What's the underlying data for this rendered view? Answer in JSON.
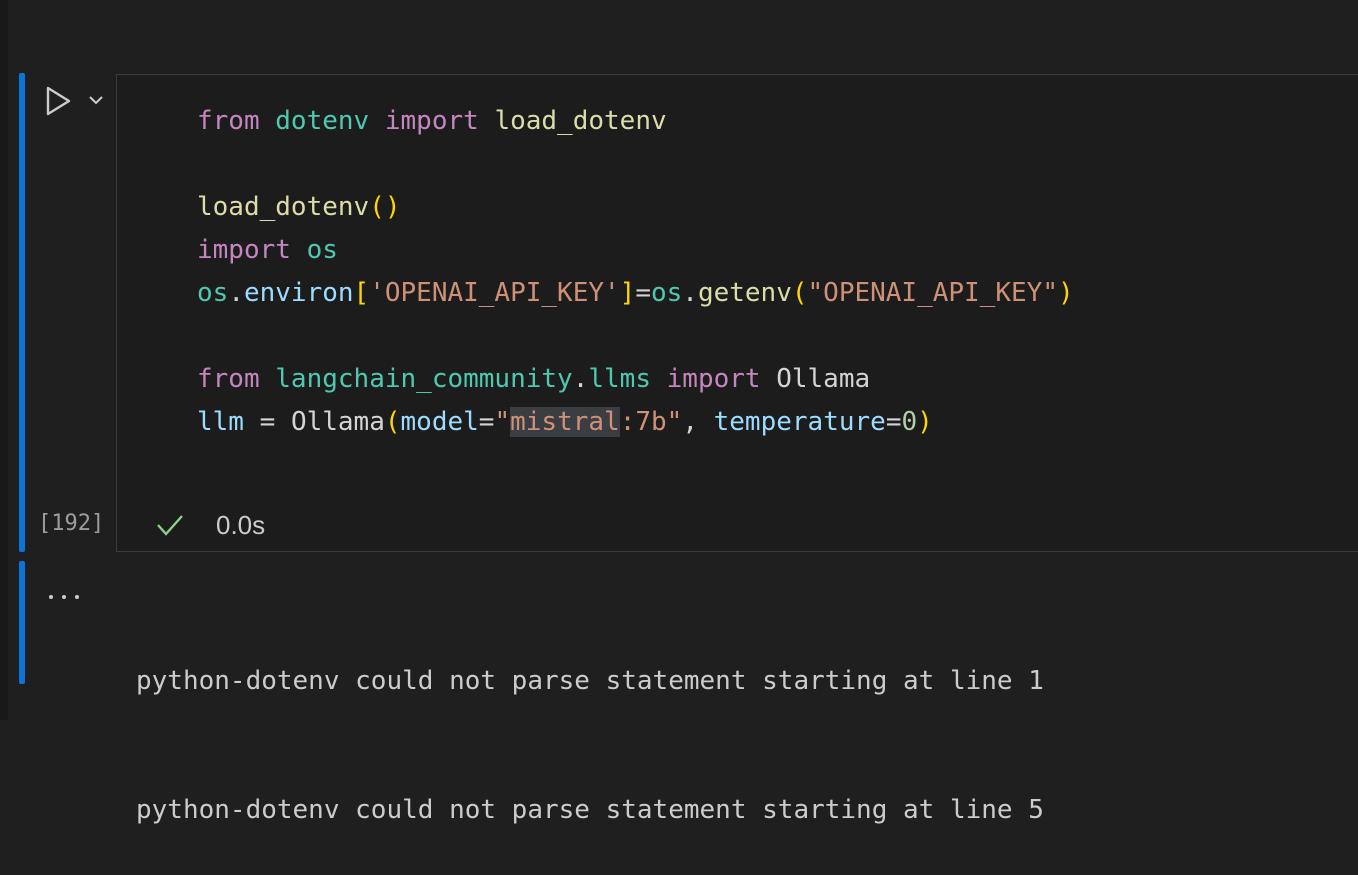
{
  "cell": {
    "code_lines": [
      [
        {
          "t": "from",
          "c": "kw"
        },
        {
          "t": " ",
          "c": "pl"
        },
        {
          "t": "dotenv",
          "c": "mod"
        },
        {
          "t": " ",
          "c": "pl"
        },
        {
          "t": "import",
          "c": "kw"
        },
        {
          "t": " ",
          "c": "pl"
        },
        {
          "t": "load_dotenv",
          "c": "fn"
        }
      ],
      [],
      [
        {
          "t": "load_dotenv",
          "c": "fn"
        },
        {
          "t": "()",
          "c": "br1"
        }
      ],
      [
        {
          "t": "import",
          "c": "kw"
        },
        {
          "t": " ",
          "c": "pl"
        },
        {
          "t": "os",
          "c": "mod"
        }
      ],
      [
        {
          "t": "os",
          "c": "mod"
        },
        {
          "t": ".",
          "c": "pl"
        },
        {
          "t": "environ",
          "c": "var"
        },
        {
          "t": "[",
          "c": "br1"
        },
        {
          "t": "'OPENAI_API_KEY'",
          "c": "str"
        },
        {
          "t": "]",
          "c": "br1"
        },
        {
          "t": "=",
          "c": "pl"
        },
        {
          "t": "os",
          "c": "mod"
        },
        {
          "t": ".",
          "c": "pl"
        },
        {
          "t": "getenv",
          "c": "fn"
        },
        {
          "t": "(",
          "c": "br1"
        },
        {
          "t": "\"OPENAI_API_KEY\"",
          "c": "str"
        },
        {
          "t": ")",
          "c": "br1"
        }
      ],
      [],
      [
        {
          "t": "from",
          "c": "kw"
        },
        {
          "t": " ",
          "c": "pl"
        },
        {
          "t": "langchain_community",
          "c": "mod"
        },
        {
          "t": ".",
          "c": "pl"
        },
        {
          "t": "llms",
          "c": "mod"
        },
        {
          "t": " ",
          "c": "pl"
        },
        {
          "t": "import",
          "c": "kw"
        },
        {
          "t": " ",
          "c": "pl"
        },
        {
          "t": "Ollama",
          "c": "pl"
        }
      ],
      [
        {
          "t": "llm",
          "c": "var"
        },
        {
          "t": " = ",
          "c": "pl"
        },
        {
          "t": "Ollama",
          "c": "pl"
        },
        {
          "t": "(",
          "c": "br1"
        },
        {
          "t": "model",
          "c": "var"
        },
        {
          "t": "=",
          "c": "pl"
        },
        {
          "t": "\"",
          "c": "str"
        },
        {
          "t": "mistral",
          "c": "str sel"
        },
        {
          "t": ":7b\"",
          "c": "str"
        },
        {
          "t": ", ",
          "c": "pl"
        },
        {
          "t": "temperature",
          "c": "var"
        },
        {
          "t": "=",
          "c": "pl"
        },
        {
          "t": "0",
          "c": "num"
        },
        {
          "t": ")",
          "c": "br1"
        }
      ]
    ],
    "execution_count": "[192]",
    "status_icon": "check-icon",
    "duration": "0.0s"
  },
  "output": {
    "more_icon": "ellipsis-icon",
    "lines": [
      "python-dotenv could not parse statement starting at line 1",
      "python-dotenv could not parse statement starting at line 5"
    ]
  },
  "colors": {
    "accent": "#0b74d8",
    "success": "#89d185",
    "editor_bg": "#1c1c1c",
    "page_bg": "#1f1f1f"
  }
}
